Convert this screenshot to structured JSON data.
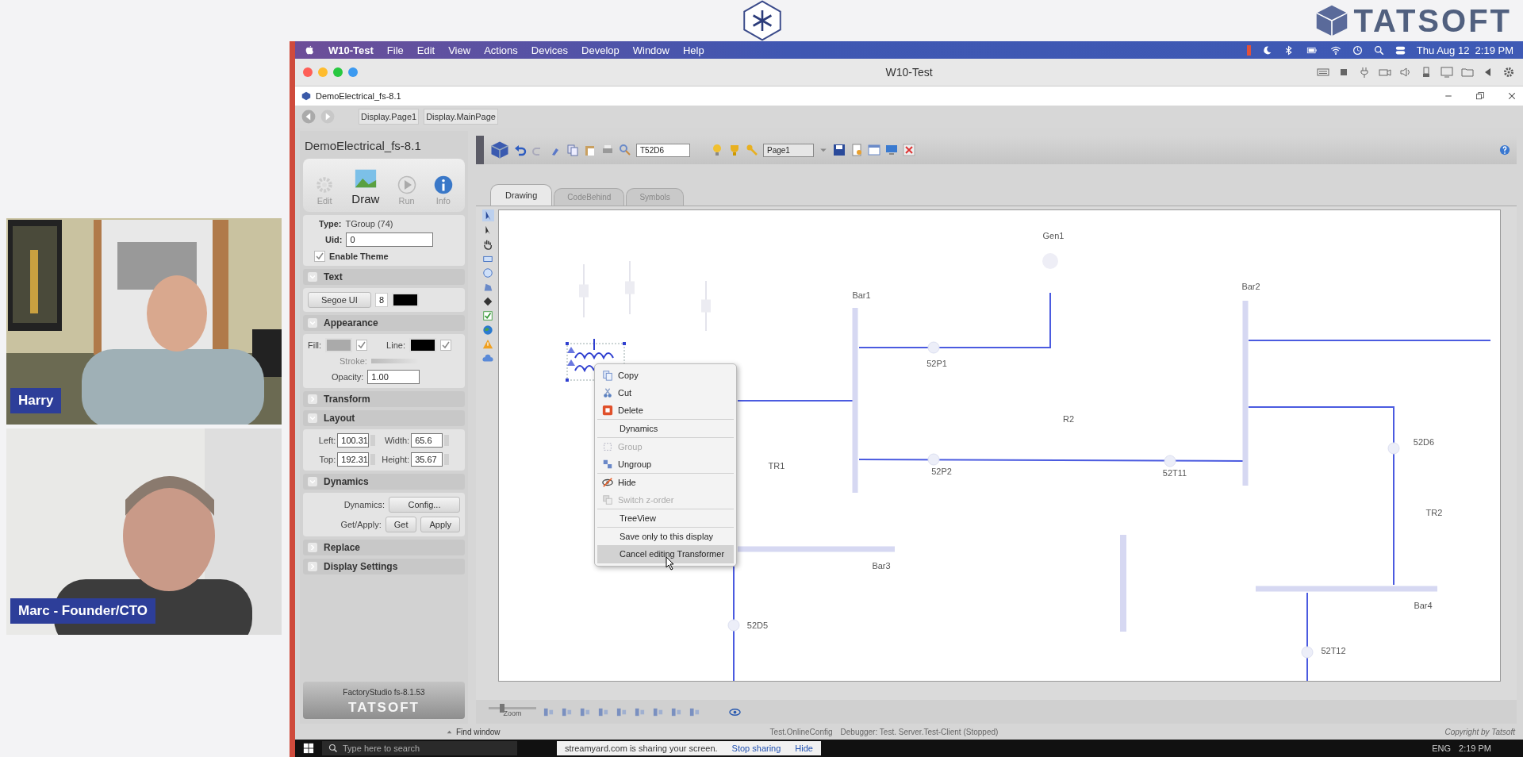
{
  "brand": {
    "name": "TATSOFT"
  },
  "participants": [
    {
      "name": "Harry"
    },
    {
      "name": "Marc - Founder/CTO"
    }
  ],
  "mac_menubar": {
    "app": "W10-Test",
    "menus": [
      "File",
      "Edit",
      "View",
      "Actions",
      "Devices",
      "Develop",
      "Window",
      "Help"
    ],
    "clock": "Thu Aug 12  2:19 PM"
  },
  "vm_window": {
    "title": "W10-Test"
  },
  "app_window": {
    "title": "DemoElectrical_fs-8.1",
    "breadcrumbs": [
      "Display.Page1",
      "Display.MainPage"
    ]
  },
  "side_panel": {
    "project": "DemoElectrical_fs-8.1",
    "modes": [
      {
        "label": "Edit",
        "selected": false
      },
      {
        "label": "Draw",
        "selected": true
      },
      {
        "label": "Run",
        "selected": false
      },
      {
        "label": "Info",
        "selected": false
      }
    ],
    "type_label": "Type:",
    "type_value": "TGroup (74)",
    "uid_label": "Uid:",
    "uid_value": "0",
    "enable_theme": {
      "label": "Enable Theme",
      "checked": true
    },
    "sections": [
      {
        "kind": "text",
        "title": "Text",
        "expanded": true,
        "font": "Segoe UI",
        "size": "8"
      },
      {
        "kind": "appearance",
        "title": "Appearance",
        "expanded": true,
        "fill_label": "Fill:",
        "fill_checked": true,
        "line_label": "Line:",
        "line_checked": true,
        "stroke_label": "Stroke:",
        "opacity_label": "Opacity:",
        "opacity": "1.00"
      },
      {
        "title": "Transform",
        "expanded": false
      },
      {
        "kind": "layout",
        "title": "Layout",
        "expanded": true,
        "fields": [
          {
            "label": "Left:",
            "value": "100.31"
          },
          {
            "label": "Width:",
            "value": "65.6"
          },
          {
            "label": "Top:",
            "value": "192.31"
          },
          {
            "label": "Height:",
            "value": "35.67"
          }
        ]
      },
      {
        "kind": "dynamics",
        "title": "Dynamics",
        "expanded": true,
        "dynamics_label": "Dynamics:",
        "config_button": "Config...",
        "get_apply_label": "Get/Apply:",
        "get_button": "Get",
        "apply_button": "Apply"
      },
      {
        "title": "Replace",
        "expanded": false
      },
      {
        "title": "Display Settings",
        "expanded": false
      }
    ],
    "footer": {
      "product": "FactoryStudio fs-8.1.53",
      "brand": "TATSOFT"
    }
  },
  "toolbar": {
    "search_value": "T52D6",
    "page": "Page1"
  },
  "tabs": [
    {
      "label": "Drawing",
      "selected": true
    },
    {
      "label": "CodeBehind",
      "selected": false
    },
    {
      "label": "Symbols",
      "selected": false
    }
  ],
  "diagram": {
    "labels": [
      "Gen1",
      "Bar1",
      "Bar2",
      "52P1",
      "R2",
      "52D6",
      "TR1",
      "52P2",
      "52T11",
      "TR2",
      "Bar3",
      "Bar4",
      "52D5",
      "52T12"
    ]
  },
  "context_menu": {
    "groups": [
      [
        {
          "label": "Copy",
          "disabled": false,
          "selected": false
        },
        {
          "label": "Cut",
          "disabled": false,
          "selected": false
        },
        {
          "label": "Delete",
          "disabled": false,
          "selected": false
        }
      ],
      [
        {
          "label": "Dynamics",
          "disabled": false,
          "selected": false
        }
      ],
      [
        {
          "label": "Group",
          "disabled": true,
          "selected": false
        },
        {
          "label": "Ungroup",
          "disabled": false,
          "selected": false
        }
      ],
      [
        {
          "label": "Hide",
          "disabled": false,
          "selected": false
        },
        {
          "label": "Switch z-order",
          "disabled": true,
          "selected": false
        }
      ],
      [
        {
          "label": "TreeView",
          "disabled": false,
          "selected": false
        }
      ],
      [
        {
          "label": "Save only to this display",
          "disabled": false,
          "selected": false
        },
        {
          "label": "Cancel editing Transformer",
          "disabled": false,
          "selected": true
        }
      ]
    ]
  },
  "zoom": {
    "label": "Zoom",
    "level": 0.25
  },
  "status_bar": {
    "find": "Find window",
    "config": "Test.OnlineConfig",
    "debugger": "Debugger: Test. Server.Test-Client (Stopped)",
    "copyright": "Copyright by Tatsoft"
  },
  "taskbar": {
    "search_placeholder": "Type here to search",
    "share_notice": "streamyard.com is sharing your screen.",
    "stop_button": "Stop sharing",
    "hide_button": "Hide",
    "language": "ENG",
    "time": "2:19 PM"
  }
}
